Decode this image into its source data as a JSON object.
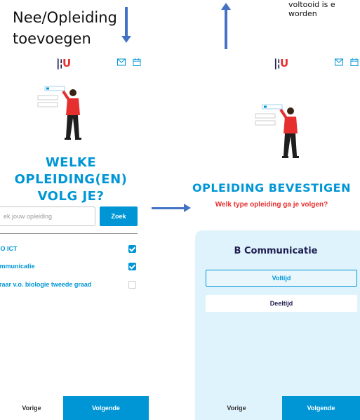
{
  "annotations": {
    "caption_line1": "Nee/Opleiding",
    "caption_line2": "toevoegen",
    "note_line1": "voltooid is e",
    "note_line2": "worden"
  },
  "left_screen": {
    "logo_bars": "|¦",
    "logo_letter": "U",
    "title_line1": "WELKE OPLEIDING(EN)",
    "title_line2": "VOLG JE?",
    "search_placeholder": "ek jouw opleiding",
    "search_button": "Zoek",
    "options": [
      {
        "label": "BO ICT",
        "checked": true
      },
      {
        "label": "ommunicatie",
        "checked": true
      },
      {
        "label": "eraar v.o. biologie tweede graad",
        "checked": false
      }
    ],
    "prev_label": "Vorige",
    "next_label": "Volgende"
  },
  "right_screen": {
    "logo_bars": "|¦",
    "logo_letter": "U",
    "title": "OPLEIDING BEVESTIGEN",
    "subtitle": "Welk type opleiding ga je volgen?",
    "panel_title": "B Communicatie",
    "choices": [
      {
        "label": "Voltijd",
        "selected": true
      },
      {
        "label": "Deeltijd",
        "selected": false
      }
    ],
    "prev_label": "Vorige",
    "next_label": "Volgende"
  },
  "colors": {
    "accent": "#0096d6",
    "brand_red": "#e63030",
    "dark_navy": "#1e1e50",
    "arrow_blue": "#4472c4",
    "panel_bg": "#dff3fc"
  },
  "icons": [
    "mail-icon",
    "calendar-icon"
  ]
}
